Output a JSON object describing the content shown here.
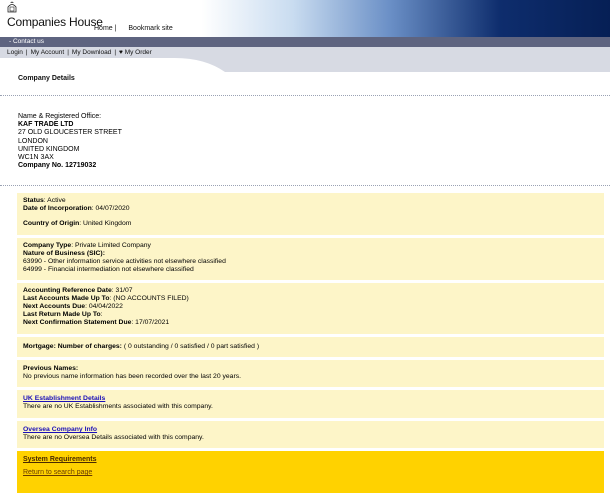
{
  "header": {
    "logo_text": "Companies House",
    "links": [
      "Home |",
      "Bookmark site"
    ]
  },
  "nav": {
    "contact": "- Contact us",
    "items": [
      "Login",
      "My Account",
      "My Download",
      "My Order"
    ],
    "separator": "|"
  },
  "page_title": "Company Details",
  "registered_office": {
    "label": "Name & Registered Office:",
    "name": "KAF TRADE LTD",
    "address_lines": [
      "27 OLD GLOUCESTER STREET",
      "LONDON",
      "UNITED KINGDOM",
      "WC1N 3AX"
    ],
    "company_no_label": "Company No.",
    "company_no": "12719032"
  },
  "status_box": {
    "status_label": "Status",
    "status_value": ": Active",
    "incorporation_label": "Date of Incorporation",
    "incorporation_value": ": 04/07/2020",
    "country_label": "Country of Origin",
    "country_value": ": United Kingdom"
  },
  "type_box": {
    "type_label": "Company Type",
    "type_value": ": Private Limited Company",
    "nature_label": "Nature of Business (SIC):",
    "sic": [
      "63990 - Other information service activities not elsewhere classified",
      "64999 - Financial intermediation not elsewhere classified"
    ]
  },
  "accounts_box": {
    "ard_label": "Accounting Reference Date",
    "ard_value": ": 31/07",
    "last_accounts_label": "Last Accounts Made Up To",
    "last_accounts_value": ": (NO ACCOUNTS FILED)",
    "next_accounts_label": "Next Accounts Due",
    "next_accounts_value": ": 04/04/2022",
    "last_return_label": "Last Return Made Up To",
    "last_return_value": ":",
    "next_conf_label": "Next Confirmation Statement Due",
    "next_conf_value": ": 17/07/2021"
  },
  "mortgage_box": {
    "label": "Mortgage: Number of charges:",
    "value": " ( 0 outstanding / 0 satisfied / 0 part satisfied )"
  },
  "previous_names_box": {
    "label": "Previous Names:",
    "text": "No previous name information has been recorded over the last 20 years."
  },
  "uk_establishment_box": {
    "link": "UK Establishment Details",
    "text": "There are no UK Establishments associated with this company."
  },
  "oversea_box": {
    "link": "Oversea Company Info",
    "text": "There are no Oversea Details associated with this company."
  },
  "footer_links": {
    "system_requirements": "System Requirements",
    "return": "Return to search page"
  }
}
